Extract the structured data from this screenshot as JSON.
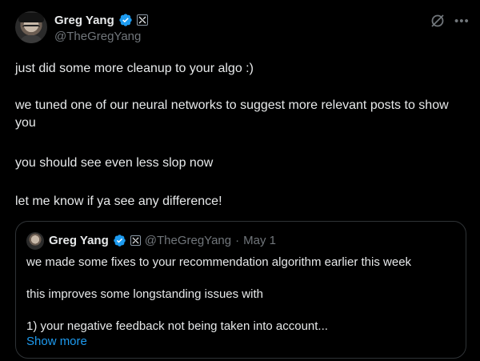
{
  "author": {
    "display_name": "Greg Yang",
    "handle": "@TheGregYang",
    "affiliation_badge": "x-ai-logo"
  },
  "post": {
    "lines": [
      "just did some more cleanup to your algo :)",
      "we tuned one of our neural networks to suggest more relevant posts to show you",
      "you should see even less slop now",
      "let me know if ya see any difference!"
    ]
  },
  "quoted": {
    "display_name": "Greg Yang",
    "handle": "@TheGregYang",
    "separator": "·",
    "date": "May 1",
    "lines": [
      "we made some fixes to your recommendation algorithm earlier this week",
      "this improves some longstanding issues with",
      "1) your negative feedback not being taken into account..."
    ],
    "show_more": "Show more"
  },
  "icons": {
    "verified": "verified-badge-icon",
    "grok": "grok-icon",
    "more": "more-options-icon"
  },
  "colors": {
    "background": "#000000",
    "text": "#e7e9ea",
    "secondary": "#71767b",
    "accent": "#1d9bf0",
    "border": "#2f3336"
  }
}
